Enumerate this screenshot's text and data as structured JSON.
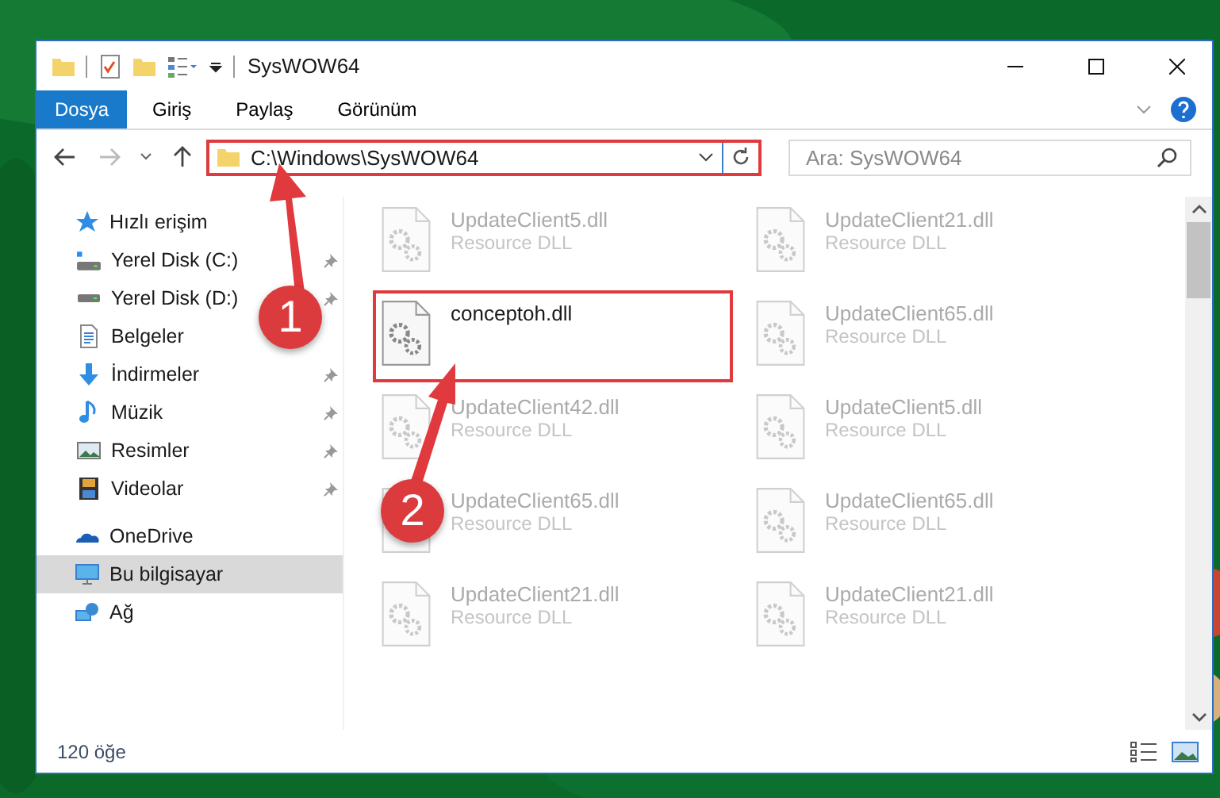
{
  "window": {
    "title": "SysWOW64"
  },
  "ribbon": {
    "file_tab": "Dosya",
    "tabs": [
      "Giriş",
      "Paylaş",
      "Görünüm"
    ]
  },
  "address": {
    "path": "C:\\Windows\\SysWOW64",
    "highlighted": true
  },
  "search": {
    "placeholder": "Ara: SysWOW64"
  },
  "sidebar": {
    "items": [
      {
        "label": "Hızlı erişim",
        "kind": "quick-access",
        "selected": false,
        "children": [
          {
            "label": "Yerel Disk (C:)",
            "kind": "system-drive",
            "pinned": true,
            "selected": false
          },
          {
            "label": "Yerel Disk (D:)",
            "kind": "drive",
            "pinned": true,
            "selected": false
          },
          {
            "label": "Belgeler",
            "kind": "documents",
            "pinned": false,
            "selected": false
          },
          {
            "label": "İndirmeler",
            "kind": "downloads",
            "pinned": true,
            "selected": false
          },
          {
            "label": "Müzik",
            "kind": "music",
            "pinned": true,
            "selected": false
          },
          {
            "label": "Resimler",
            "kind": "pictures",
            "pinned": true,
            "selected": false
          },
          {
            "label": "Videolar",
            "kind": "videos",
            "pinned": true,
            "selected": false
          }
        ]
      },
      {
        "label": "OneDrive",
        "kind": "onedrive",
        "selected": false
      },
      {
        "label": "Bu bilgisayar",
        "kind": "pc",
        "selected": true
      },
      {
        "label": "Ağ",
        "kind": "network",
        "selected": false
      }
    ]
  },
  "files": [
    {
      "name": "UpdateClient5.dll",
      "type": "Resource DLL",
      "highlighted": false
    },
    {
      "name": "UpdateClient21.dll",
      "type": "Resource DLL",
      "highlighted": false
    },
    {
      "name": "conceptoh.dll",
      "highlighted": true
    },
    {
      "name": "UpdateClient65.dll",
      "type": "Resource DLL",
      "highlighted": false
    },
    {
      "name": "UpdateClient42.dll",
      "type": "Resource DLL",
      "highlighted": false
    },
    {
      "name": "UpdateClient5.dll",
      "type": "Resource DLL",
      "highlighted": false
    },
    {
      "name": "UpdateClient65.dll",
      "type": "Resource DLL",
      "highlighted": false
    },
    {
      "name": "UpdateClient65.dll",
      "type": "Resource DLL",
      "highlighted": false
    },
    {
      "name": "UpdateClient21.dll",
      "type": "Resource DLL",
      "highlighted": false
    },
    {
      "name": "UpdateClient21.dll",
      "type": "Resource DLL",
      "highlighted": false
    }
  ],
  "status_bar": {
    "item_count": "120 öğe"
  },
  "callouts": [
    "1",
    "2"
  ]
}
